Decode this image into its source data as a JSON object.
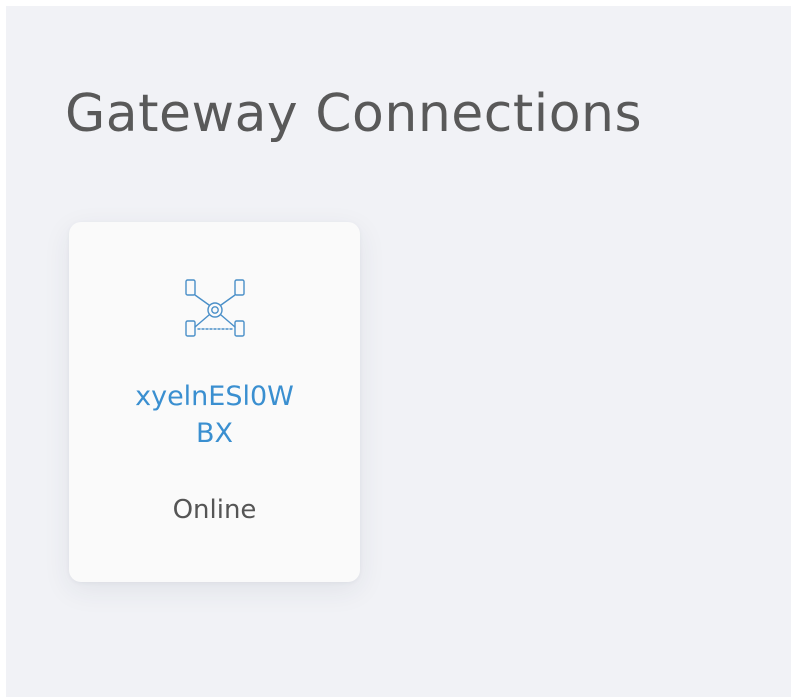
{
  "page": {
    "title": "Gateway Connections"
  },
  "gateways": [
    {
      "name": "xyelnESl0WBX",
      "status": "Online",
      "icon": "gateway-network-icon"
    }
  ],
  "colors": {
    "background": "#f1f2f6",
    "card": "#fafafa",
    "link": "#3a8fd0",
    "icon": "#4a8fc8",
    "title": "#595959",
    "status_text": "#555555"
  }
}
